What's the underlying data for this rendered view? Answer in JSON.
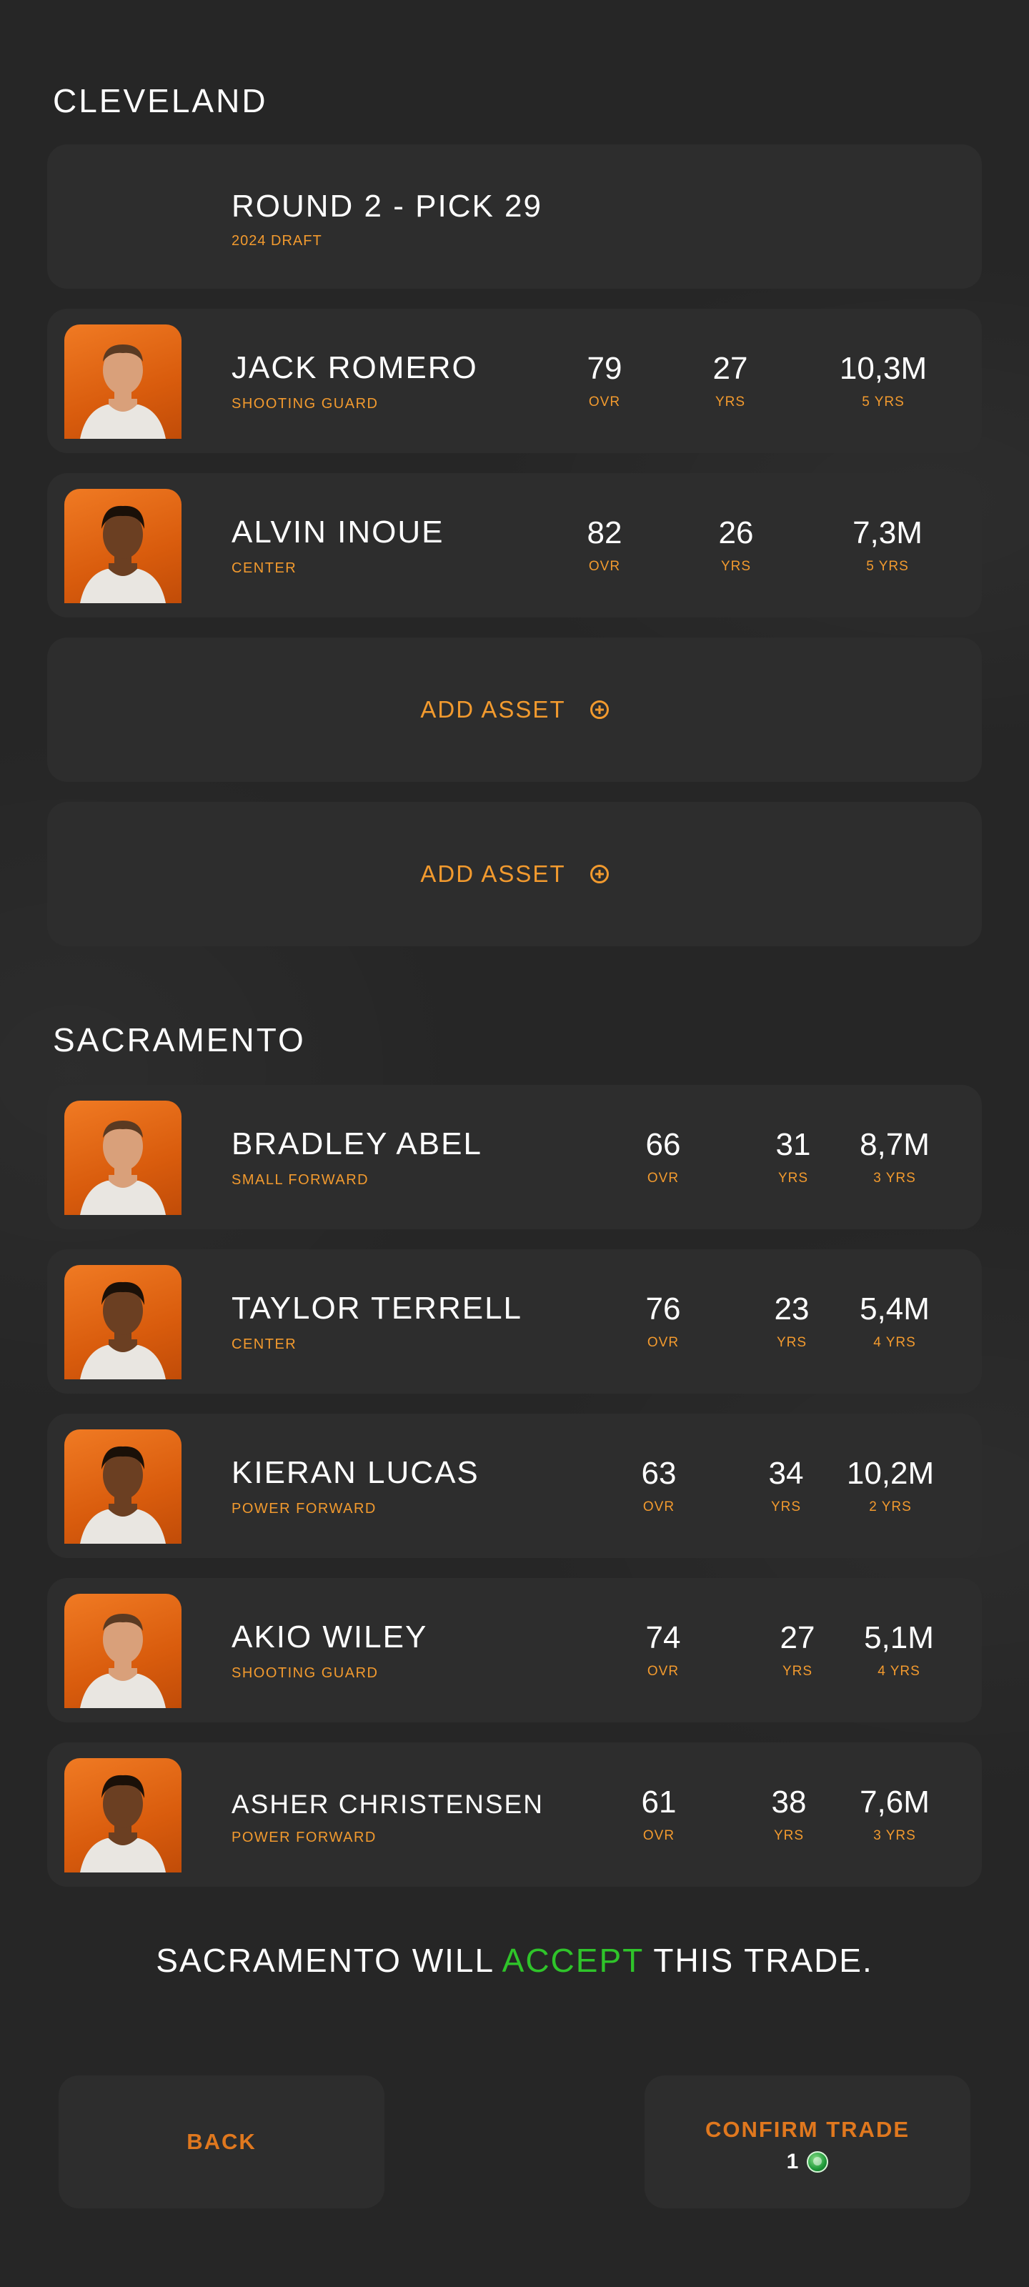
{
  "teams": {
    "a": {
      "name": "CLEVELAND",
      "pick": {
        "title": "ROUND 2 - PICK 29",
        "subtitle": "2024 DRAFT"
      },
      "players": [
        {
          "name": "JACK ROMERO",
          "position": "SHOOTING GUARD",
          "ovr": "79",
          "ovr_label": "OVR",
          "age": "27",
          "age_label": "YRS",
          "salary": "10,3M",
          "contract": "5 YRS"
        },
        {
          "name": "ALVIN INOUE",
          "position": "CENTER",
          "ovr": "82",
          "ovr_label": "OVR",
          "age": "26",
          "age_label": "YRS",
          "salary": "7,3M",
          "contract": "5 YRS"
        }
      ],
      "add_asset_label": "ADD ASSET"
    },
    "b": {
      "name": "SACRAMENTO",
      "players": [
        {
          "name": "BRADLEY ABEL",
          "position": "SMALL FORWARD",
          "ovr": "66",
          "ovr_label": "OVR",
          "age": "31",
          "age_label": "YRS",
          "salary": "8,7M",
          "contract": "3 YRS"
        },
        {
          "name": "TAYLOR TERRELL",
          "position": "CENTER",
          "ovr": "76",
          "ovr_label": "OVR",
          "age": "23",
          "age_label": "YRS",
          "salary": "5,4M",
          "contract": "4 YRS"
        },
        {
          "name": "KIERAN LUCAS",
          "position": "POWER FORWARD",
          "ovr": "63",
          "ovr_label": "OVR",
          "age": "34",
          "age_label": "YRS",
          "salary": "10,2M",
          "contract": "2 YRS"
        },
        {
          "name": "AKIO WILEY",
          "position": "SHOOTING GUARD",
          "ovr": "74",
          "ovr_label": "OVR",
          "age": "27",
          "age_label": "YRS",
          "salary": "5,1M",
          "contract": "4 YRS"
        },
        {
          "name": "ASHER CHRISTENSEN",
          "position": "POWER FORWARD",
          "ovr": "61",
          "ovr_label": "OVR",
          "age": "38",
          "age_label": "YRS",
          "salary": "7,6M",
          "contract": "3 YRS"
        }
      ]
    }
  },
  "verdict": {
    "prefix": "SACRAMENTO WILL ",
    "highlight": "ACCEPT",
    "suffix": " THIS TRADE."
  },
  "buttons": {
    "back": "BACK",
    "confirm": "CONFIRM TRADE",
    "confirm_cost": "1"
  },
  "colors": {
    "accent": "#f29a2e",
    "accept": "#2fc42a",
    "card": "#2d2d2d",
    "background": "#262626",
    "avatar_orange": "#e5681a"
  },
  "icons": {
    "add": "plus-circle-icon",
    "currency": "coin-icon"
  }
}
